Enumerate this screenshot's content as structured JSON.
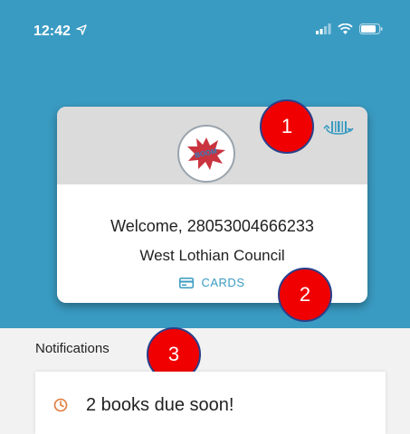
{
  "status_bar": {
    "time": "12:42"
  },
  "card": {
    "welcome": "Welcome, 28053004666233",
    "council": "West Lothian Council",
    "cards_label": "CARDS",
    "logo_text": "BOOM"
  },
  "badges": [
    "1",
    "2",
    "3"
  ],
  "notifications": {
    "heading": "Notifications",
    "items": [
      {
        "text": "2 books due soon!"
      }
    ]
  },
  "colors": {
    "header": "#3a9bc2",
    "badge": "#f00000",
    "accent": "#3a9bc2",
    "clock_icon": "#e07b39"
  }
}
